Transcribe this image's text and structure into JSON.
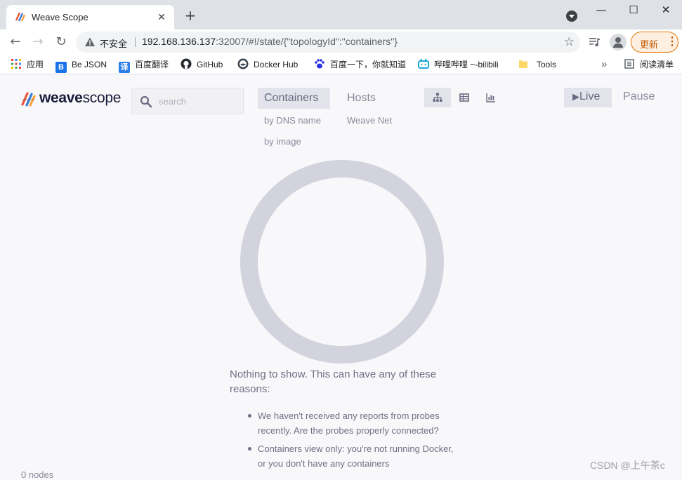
{
  "browser": {
    "tab_title": "Weave Scope",
    "tab_close": "✕",
    "new_tab": "+",
    "window_minimize": "—",
    "window_maximize": "☐",
    "window_close": "✕",
    "back": "←",
    "forward": "→",
    "reload": "↻",
    "security_label": "不安全",
    "url_host": "192.168.136.137",
    "url_rest": ":32007/#!/state/{\"topologyId\":\"containers\"}",
    "star": "☆",
    "update_label": "更新",
    "update_menu": "⋮"
  },
  "bookmarks": {
    "items": [
      {
        "label": "应用",
        "icon": "apps-grid-icon"
      },
      {
        "label": "Be JSON",
        "icon": "bejson-icon",
        "glyph": "B",
        "color": "#1a73e8"
      },
      {
        "label": "百度翻译",
        "icon": "baidu-translate-icon",
        "glyph": "译",
        "color": "#2b7de9"
      },
      {
        "label": "GitHub",
        "icon": "github-icon"
      },
      {
        "label": "Docker Hub",
        "icon": "docker-icon"
      },
      {
        "label": "百度一下，你就知道",
        "icon": "baidu-paw-icon"
      },
      {
        "label": "哔哩哔哩 ~-bilibili",
        "icon": "bilibili-icon"
      },
      {
        "label": "Tools",
        "icon": "folder-icon"
      }
    ],
    "more": "»",
    "reading_list": "阅读清单"
  },
  "app": {
    "logo_bold": "weave",
    "logo_light": "scope",
    "search_placeholder": "search",
    "topologies": [
      {
        "label": "Containers",
        "active": true,
        "sub": [
          "by DNS name",
          "by image"
        ]
      },
      {
        "label": "Hosts",
        "active": false,
        "sub": [
          "Weave Net"
        ]
      }
    ],
    "views": [
      {
        "name": "graph-view",
        "active": true
      },
      {
        "name": "table-view",
        "active": false
      },
      {
        "name": "resources-view",
        "active": false
      }
    ],
    "live_label": "Live",
    "pause_label": "Pause",
    "empty": {
      "title": "Nothing to show. This can have any of these reasons:",
      "reasons": [
        "We haven't received any reports from probes recently. Are the probes properly connected?",
        "Containers view only: you're not running Docker, or you don't have any containers"
      ]
    },
    "node_count": "0 nodes"
  },
  "watermark": "CSDN @上午茶c",
  "colors": {
    "accent_bg": "#e3e3eb",
    "ring": "#d3d3de",
    "text": "#6f6f84",
    "update_orange": "#e37400"
  }
}
